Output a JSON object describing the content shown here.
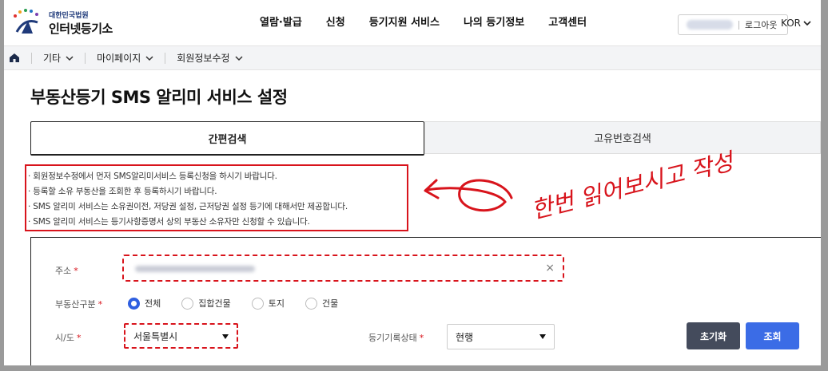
{
  "header": {
    "logo_sub": "대한민국법원",
    "logo_main": "인터넷등기소",
    "nav": [
      "열람·발급",
      "신청",
      "등기지원 서비스",
      "나의 등기정보",
      "고객센터"
    ],
    "logout": "로그아웃",
    "lang": "KOR"
  },
  "breadcrumb": {
    "items": [
      "기타",
      "마이페이지",
      "회원정보수정"
    ]
  },
  "page": {
    "title": "부동산등기 SMS 알리미 서비스 설정"
  },
  "tabs": {
    "active": "간편검색",
    "inactive": "고유번호검색"
  },
  "notices": [
    "· 회원정보수정에서 먼저 SMS알리미서비스 등록신청을 하시기 바랍니다.",
    "· 등록할 소유 부동산을 조회한 후 등록하시기 바랍니다.",
    "· SMS 알리미 서비스는 소유권이전, 저당권 설정, 근저당권 설정 등기에 대해서만 제공합니다.",
    "· SMS 알리미 서비스는 등기사항증명서 상의 부동산 소유자만 신청할 수 있습니다."
  ],
  "annotation": {
    "text": "한번 읽어보시고 작성"
  },
  "form": {
    "address_label": "주소",
    "address_clear": "×",
    "required_mark": "*",
    "property_type_label": "부동산구분",
    "property_types": [
      "전체",
      "집합건물",
      "토지",
      "건물"
    ],
    "property_type_selected": 0,
    "sido_label": "시/도",
    "sido_value": "서울특별시",
    "status_label": "등기기록상태",
    "status_value": "현행",
    "reset_label": "초기화",
    "search_label": "조회"
  },
  "colors": {
    "accent_blue": "#3b6ce6",
    "annotation_red": "#d8141c",
    "dark_button": "#444b5c"
  }
}
